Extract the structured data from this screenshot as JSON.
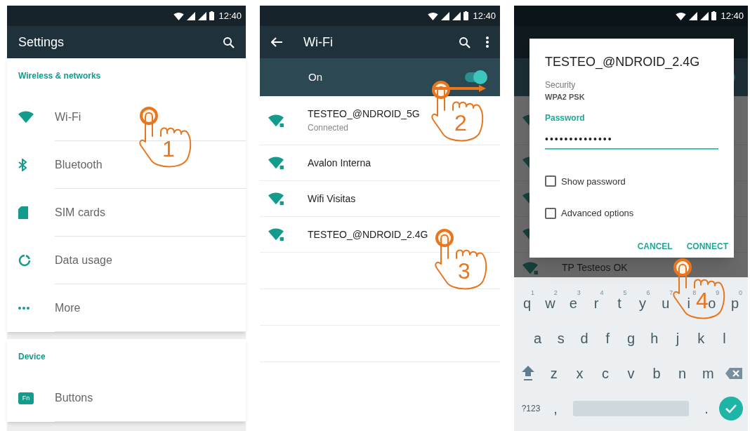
{
  "screens": [
    {
      "kind": "settings",
      "status_time": "12:40",
      "title": "Settings",
      "sections": [
        {
          "header": "Wireless & networks",
          "items": [
            {
              "kind": "wifi",
              "label": "Wi-Fi",
              "step": "1"
            },
            {
              "kind": "bluetooth",
              "label": "Bluetooth"
            },
            {
              "kind": "sim",
              "label": "SIM cards"
            },
            {
              "kind": "data",
              "label": "Data usage"
            },
            {
              "kind": "more",
              "label": "More"
            }
          ]
        },
        {
          "header": "Device",
          "items": [
            {
              "kind": "buttons",
              "icon_text": "Fn",
              "label": "Buttons"
            }
          ]
        }
      ]
    },
    {
      "kind": "wifi",
      "status_time": "12:40",
      "title": "Wi-Fi",
      "switch_label": "On",
      "switch_on": true,
      "switch_step": "2",
      "networks": [
        {
          "name": "TESTEO_@NDROID_5G",
          "status": "Connected"
        },
        {
          "name": "Avalon Interna"
        },
        {
          "name": "Wifi Visitas"
        },
        {
          "name": "TESTEO_@NDROID_2.4G",
          "step": "3"
        }
      ]
    },
    {
      "kind": "dialog",
      "status_time": "12:40",
      "background_switch_on": true,
      "background_networks": [
        {
          "name": "TP Testeos OK"
        }
      ],
      "dialog": {
        "title": "TESTEO_@NDROID_2.4G",
        "security_label": "Security",
        "security_value": "WPA2 PSK",
        "password_label": "Password",
        "password_value": "••••••••••••••",
        "checkboxes": [
          {
            "label": "Show password",
            "checked": false
          },
          {
            "label": "Advanced options",
            "checked": false
          }
        ],
        "buttons": [
          {
            "label": "CANCEL"
          },
          {
            "label": "CONNECT",
            "step": "4"
          }
        ]
      },
      "keyboard": {
        "rows": [
          [
            {
              "kind": "letter",
              "label": "q",
              "hint": "1"
            },
            {
              "kind": "letter",
              "label": "w",
              "hint": "2"
            },
            {
              "kind": "letter",
              "label": "e",
              "hint": "3"
            },
            {
              "kind": "letter",
              "label": "r",
              "hint": "4"
            },
            {
              "kind": "letter",
              "label": "t",
              "hint": "5"
            },
            {
              "kind": "letter",
              "label": "y",
              "hint": "6"
            },
            {
              "kind": "letter",
              "label": "u",
              "hint": "7"
            },
            {
              "kind": "letter",
              "label": "i",
              "hint": "8"
            },
            {
              "kind": "letter",
              "label": "o",
              "hint": "9"
            },
            {
              "kind": "letter",
              "label": "p",
              "hint": "0"
            }
          ],
          [
            {
              "kind": "letter",
              "label": "a"
            },
            {
              "kind": "letter",
              "label": "s"
            },
            {
              "kind": "letter",
              "label": "d"
            },
            {
              "kind": "letter",
              "label": "f"
            },
            {
              "kind": "letter",
              "label": "g"
            },
            {
              "kind": "letter",
              "label": "h"
            },
            {
              "kind": "letter",
              "label": "j"
            },
            {
              "kind": "letter",
              "label": "k"
            },
            {
              "kind": "letter",
              "label": "l"
            }
          ],
          [
            {
              "kind": "shift"
            },
            {
              "kind": "letter",
              "label": "z"
            },
            {
              "kind": "letter",
              "label": "x"
            },
            {
              "kind": "letter",
              "label": "c"
            },
            {
              "kind": "letter",
              "label": "v"
            },
            {
              "kind": "letter",
              "label": "b"
            },
            {
              "kind": "letter",
              "label": "n"
            },
            {
              "kind": "letter",
              "label": "m"
            },
            {
              "kind": "backspace"
            }
          ],
          [
            {
              "kind": "symbols",
              "label": "?123"
            },
            {
              "kind": "letter",
              "label": ","
            },
            {
              "kind": "space"
            },
            {
              "kind": "letter",
              "label": "."
            },
            {
              "kind": "enter"
            }
          ]
        ]
      }
    }
  ]
}
